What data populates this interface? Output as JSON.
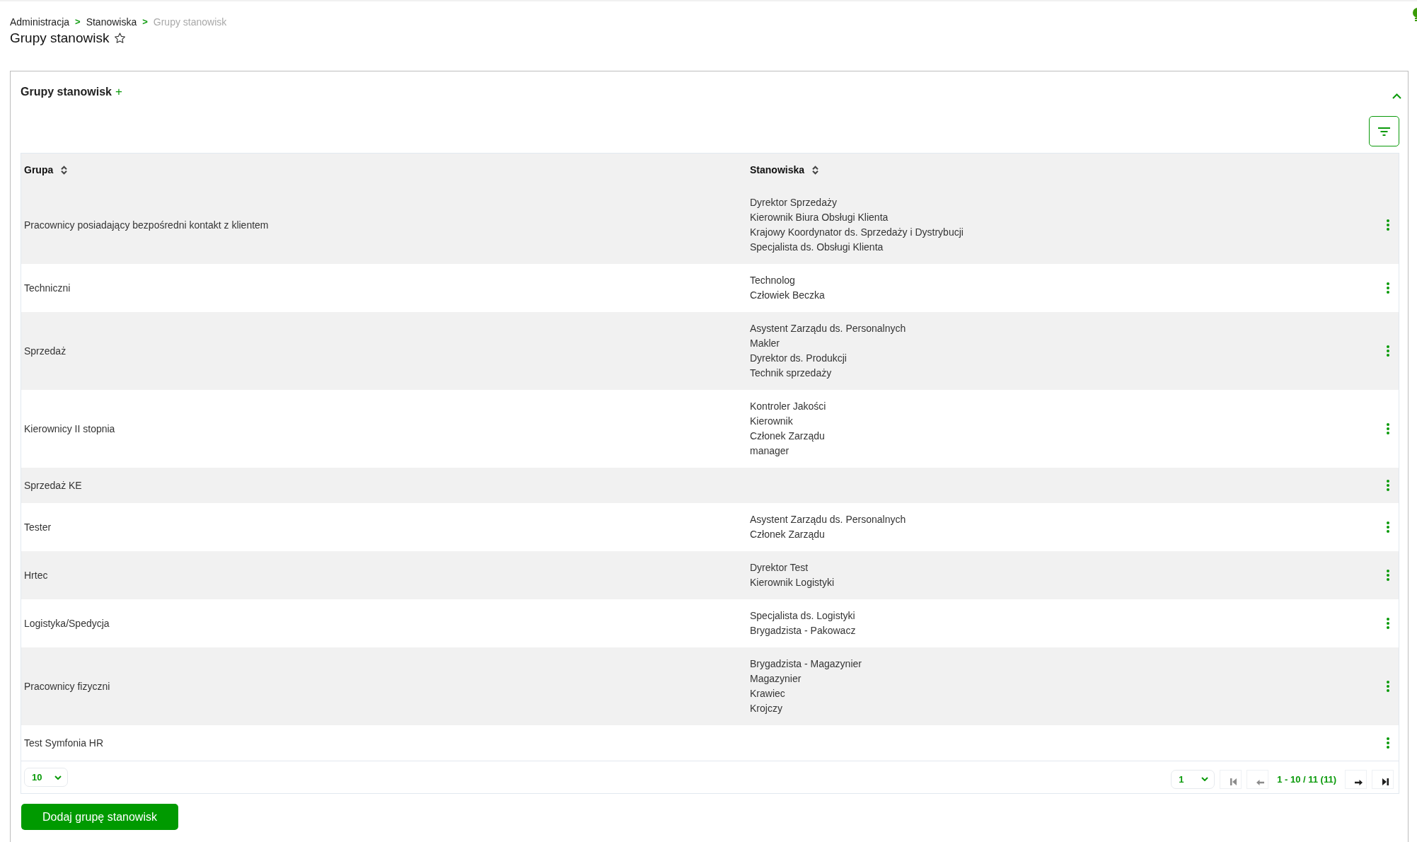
{
  "breadcrumb": [
    {
      "kind": "link",
      "label": "Administracja"
    },
    {
      "kind": "separator",
      "label": ">"
    },
    {
      "kind": "link",
      "label": "Stanowiska"
    },
    {
      "kind": "separator",
      "label": ">"
    },
    {
      "kind": "current",
      "label": "Grupy stanowisk"
    }
  ],
  "page_title": {
    "text": "Grupy stanowisk",
    "favorite": false
  },
  "panel": {
    "title": "Grupy stanowisk",
    "add_label": "+",
    "expanded": true,
    "table": {
      "columns": [
        {
          "label": "Grupa",
          "sortable": true
        },
        {
          "label": "Stanowiska",
          "sortable": true
        }
      ],
      "rows": [
        {
          "group": "Pracownicy posiadający bezpośredni kontakt z klientem",
          "positions": [
            "Dyrektor Sprzedaży",
            "Kierownik Biura Obsługi Klienta",
            "Krajowy Koordynator ds. Sprzedaży i Dystrybucji",
            "Specjalista ds. Obsługi Klienta"
          ]
        },
        {
          "group": "Techniczni",
          "positions": [
            "Technolog",
            "Człowiek Beczka"
          ]
        },
        {
          "group": "Sprzedaż",
          "positions": [
            "Asystent Zarządu ds. Personalnych",
            "Makler",
            "Dyrektor ds. Produkcji",
            "Technik sprzedaży"
          ]
        },
        {
          "group": "Kierownicy II stopnia",
          "positions": [
            "Kontroler Jakości",
            "Kierownik",
            "Członek Zarządu",
            "manager"
          ]
        },
        {
          "group": "Sprzedaż KE"
        },
        {
          "group": "Tester",
          "positions": [
            "Asystent Zarządu ds. Personalnych",
            "Członek Zarządu"
          ]
        },
        {
          "group": "Hrtec",
          "positions": [
            "Dyrektor Test",
            "Kierownik Logistyki"
          ]
        },
        {
          "group": "Logistyka/Spedycja",
          "positions": [
            "Specjalista ds. Logistyki",
            "Brygadzista - Pakowacz"
          ]
        },
        {
          "group": "Pracownicy fizyczni",
          "positions": [
            "Brygadzista - Magazynier",
            "Magazynier",
            "Krawiec",
            "Krojczy"
          ]
        },
        {
          "group": "Test Symfonia HR"
        }
      ]
    },
    "pagination": {
      "page_size": "10",
      "page": "1",
      "range": "1 - 10 / 11 (11)",
      "buttons": [
        {
          "kind": "first",
          "disabled": true
        },
        {
          "kind": "prev",
          "disabled": true
        },
        {
          "kind": "next",
          "disabled": false
        },
        {
          "kind": "last",
          "disabled": false
        }
      ]
    },
    "add_button": {
      "label": "Dodaj grupę stanowisk"
    }
  }
}
